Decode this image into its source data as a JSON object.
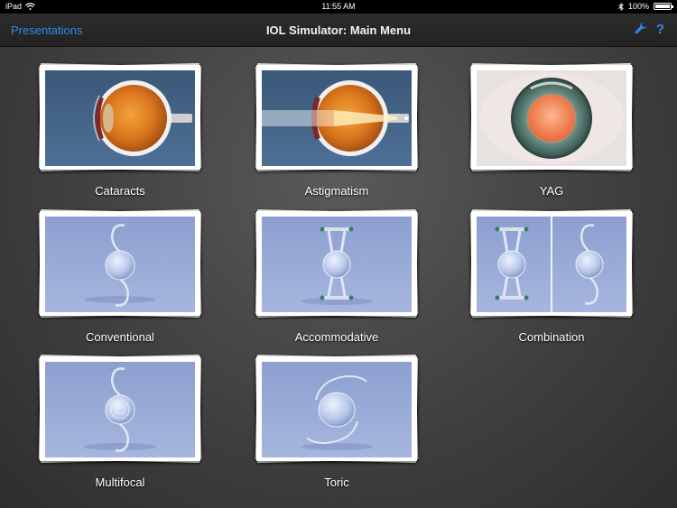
{
  "status_bar": {
    "device": "iPad",
    "time": "11:55 AM",
    "battery": "100%",
    "battery_level": 1.0,
    "icons": [
      "wifi-icon",
      "bluetooth-icon",
      "battery-icon"
    ]
  },
  "nav": {
    "back_label": "Presentations",
    "title": "IOL Simulator: Main Menu",
    "tools": [
      "wrench-icon",
      "help-icon"
    ],
    "help_label": "?"
  },
  "colors": {
    "accent": "#2a8df0",
    "background": "#404040",
    "eye_background": "#3f5f80",
    "lens_background": "#8aa0cc"
  },
  "menu": [
    {
      "label": "Cataracts",
      "thumb": "cataract-eye-cross-section"
    },
    {
      "label": "Astigmatism",
      "thumb": "astigmatism-eye-light-beam"
    },
    {
      "label": "YAG",
      "thumb": "yag-iris-closeup"
    },
    {
      "label": "Conventional",
      "thumb": "conventional-lens"
    },
    {
      "label": "Accommodative",
      "thumb": "accommodative-lens"
    },
    {
      "label": "Combination",
      "thumb": "combination-lens"
    },
    {
      "label": "Multifocal",
      "thumb": "multifocal-lens"
    },
    {
      "label": "Toric",
      "thumb": "toric-lens"
    }
  ]
}
